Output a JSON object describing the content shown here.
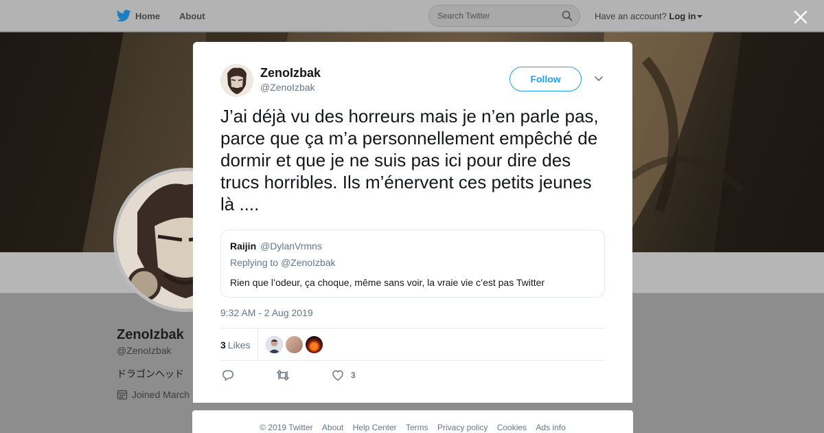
{
  "topbar": {
    "home_label": "Home",
    "about_label": "About",
    "search_placeholder": "Search Twitter",
    "account_prompt": "Have an account?",
    "login_label": "Log in"
  },
  "profile_bg": {
    "name": "ZenoIzbak",
    "handle": "@ZenoIzbak",
    "bio": "ドラゴンヘッド",
    "joined": "Joined March"
  },
  "tweet": {
    "author_name": "ZenoIzbak",
    "author_handle": "@ZenoIzbak",
    "follow_label": "Follow",
    "text": "J’ai déjà vu des horreurs mais je n’en parle pas, parce que ça m’a personnellement empêché de dormir et que je ne suis pas ici pour dire des trucs horribles. Ils m’énervent ces petits jeunes là ....",
    "quoted": {
      "name": "Raijin",
      "handle": "@DylanVrmns",
      "replying_to_label": "Replying to",
      "replying_to_handle": "@ZenoIzbak",
      "text": "Rien que l’odeur, ça choque, même sans voir, la vraie vie c’est pas Twitter"
    },
    "timestamp": "9:32 AM - 2 Aug 2019",
    "likes_count": "3",
    "likes_label": "Likes",
    "like_action_count": "3"
  },
  "footer": {
    "copyright": "© 2019 Twitter",
    "links": [
      "About",
      "Help Center",
      "Terms",
      "Privacy policy",
      "Cookies",
      "Ads info"
    ]
  },
  "colors": {
    "twitter_blue": "#1da1f2",
    "secondary_text": "#657786",
    "primary_text": "#14171a",
    "border": "#e6ecf0"
  },
  "icons": [
    "twitter-bird-icon",
    "search-icon",
    "close-icon",
    "chevron-down-icon",
    "calendar-icon",
    "reply-icon",
    "retweet-icon",
    "heart-icon"
  ]
}
